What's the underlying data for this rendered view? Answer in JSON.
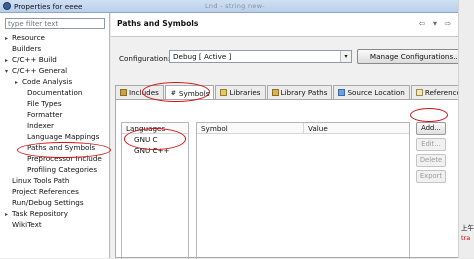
{
  "window": {
    "title": "Properties for eeee"
  },
  "background_text": "Lnd - string   new-",
  "filter": {
    "placeholder": "type filter text"
  },
  "tree": [
    {
      "label": "Resource",
      "expander": "▸",
      "level": 1
    },
    {
      "label": "Builders",
      "expander": "",
      "level": 1
    },
    {
      "label": "C/C++ Build",
      "expander": "▸",
      "level": 1
    },
    {
      "label": "C/C++ General",
      "expander": "▾",
      "level": 1
    },
    {
      "label": "Code Analysis",
      "expander": "▸",
      "level": 2
    },
    {
      "label": "Documentation",
      "expander": "",
      "level": 3
    },
    {
      "label": "File Types",
      "expander": "",
      "level": 3
    },
    {
      "label": "Formatter",
      "expander": "",
      "level": 3
    },
    {
      "label": "Indexer",
      "expander": "",
      "level": 3
    },
    {
      "label": "Language Mappings",
      "expander": "",
      "level": 3
    },
    {
      "label": "Paths and Symbols",
      "expander": "",
      "level": 3
    },
    {
      "label": "Preprocessor Include",
      "expander": "",
      "level": 3
    },
    {
      "label": "Profiling Categories",
      "expander": "",
      "level": 3
    },
    {
      "label": "Linux Tools Path",
      "expander": "",
      "level": 1
    },
    {
      "label": "Project References",
      "expander": "",
      "level": 1
    },
    {
      "label": "Run/Debug Settings",
      "expander": "",
      "level": 1
    },
    {
      "label": "Task Repository",
      "expander": "▸",
      "level": 1
    },
    {
      "label": "WikiText",
      "expander": "",
      "level": 1
    }
  ],
  "page": {
    "title": "Paths and Symbols",
    "nav": {
      "back": "⇦",
      "back_drop": "▾",
      "forward": "⇨",
      "forward_drop": "▾"
    }
  },
  "configuration": {
    "label": "Configuration:",
    "value": "Debug  [ Active ]",
    "manage_button": "Manage Configurations..."
  },
  "tabs": [
    {
      "label": "Includes",
      "icon": "include-icon",
      "glyph": "",
      "active": false
    },
    {
      "label": "Symbols",
      "icon": "hash-icon",
      "glyph": "#",
      "active": true
    },
    {
      "label": "Libraries",
      "icon": "library-icon",
      "glyph": "",
      "active": false
    },
    {
      "label": "Library Paths",
      "icon": "folder-path-icon",
      "glyph": "",
      "active": false
    },
    {
      "label": "Source Location",
      "icon": "source-folder-icon",
      "glyph": "",
      "active": false
    },
    {
      "label": "References",
      "icon": "references-icon",
      "glyph": "",
      "active": false
    }
  ],
  "languages": {
    "header": "Languages",
    "items": [
      "GNU C",
      "GNU C++"
    ]
  },
  "symbols": {
    "col_symbol": "Symbol",
    "col_value": "Value"
  },
  "buttons": {
    "add": "Add...",
    "edit": "Edit...",
    "delete": "Delete",
    "export": "Export"
  },
  "side_text": {
    "line1": "上午",
    "line2": "tra"
  },
  "colors": {
    "annotation": "#d11111",
    "accent": "#3b5f94"
  }
}
